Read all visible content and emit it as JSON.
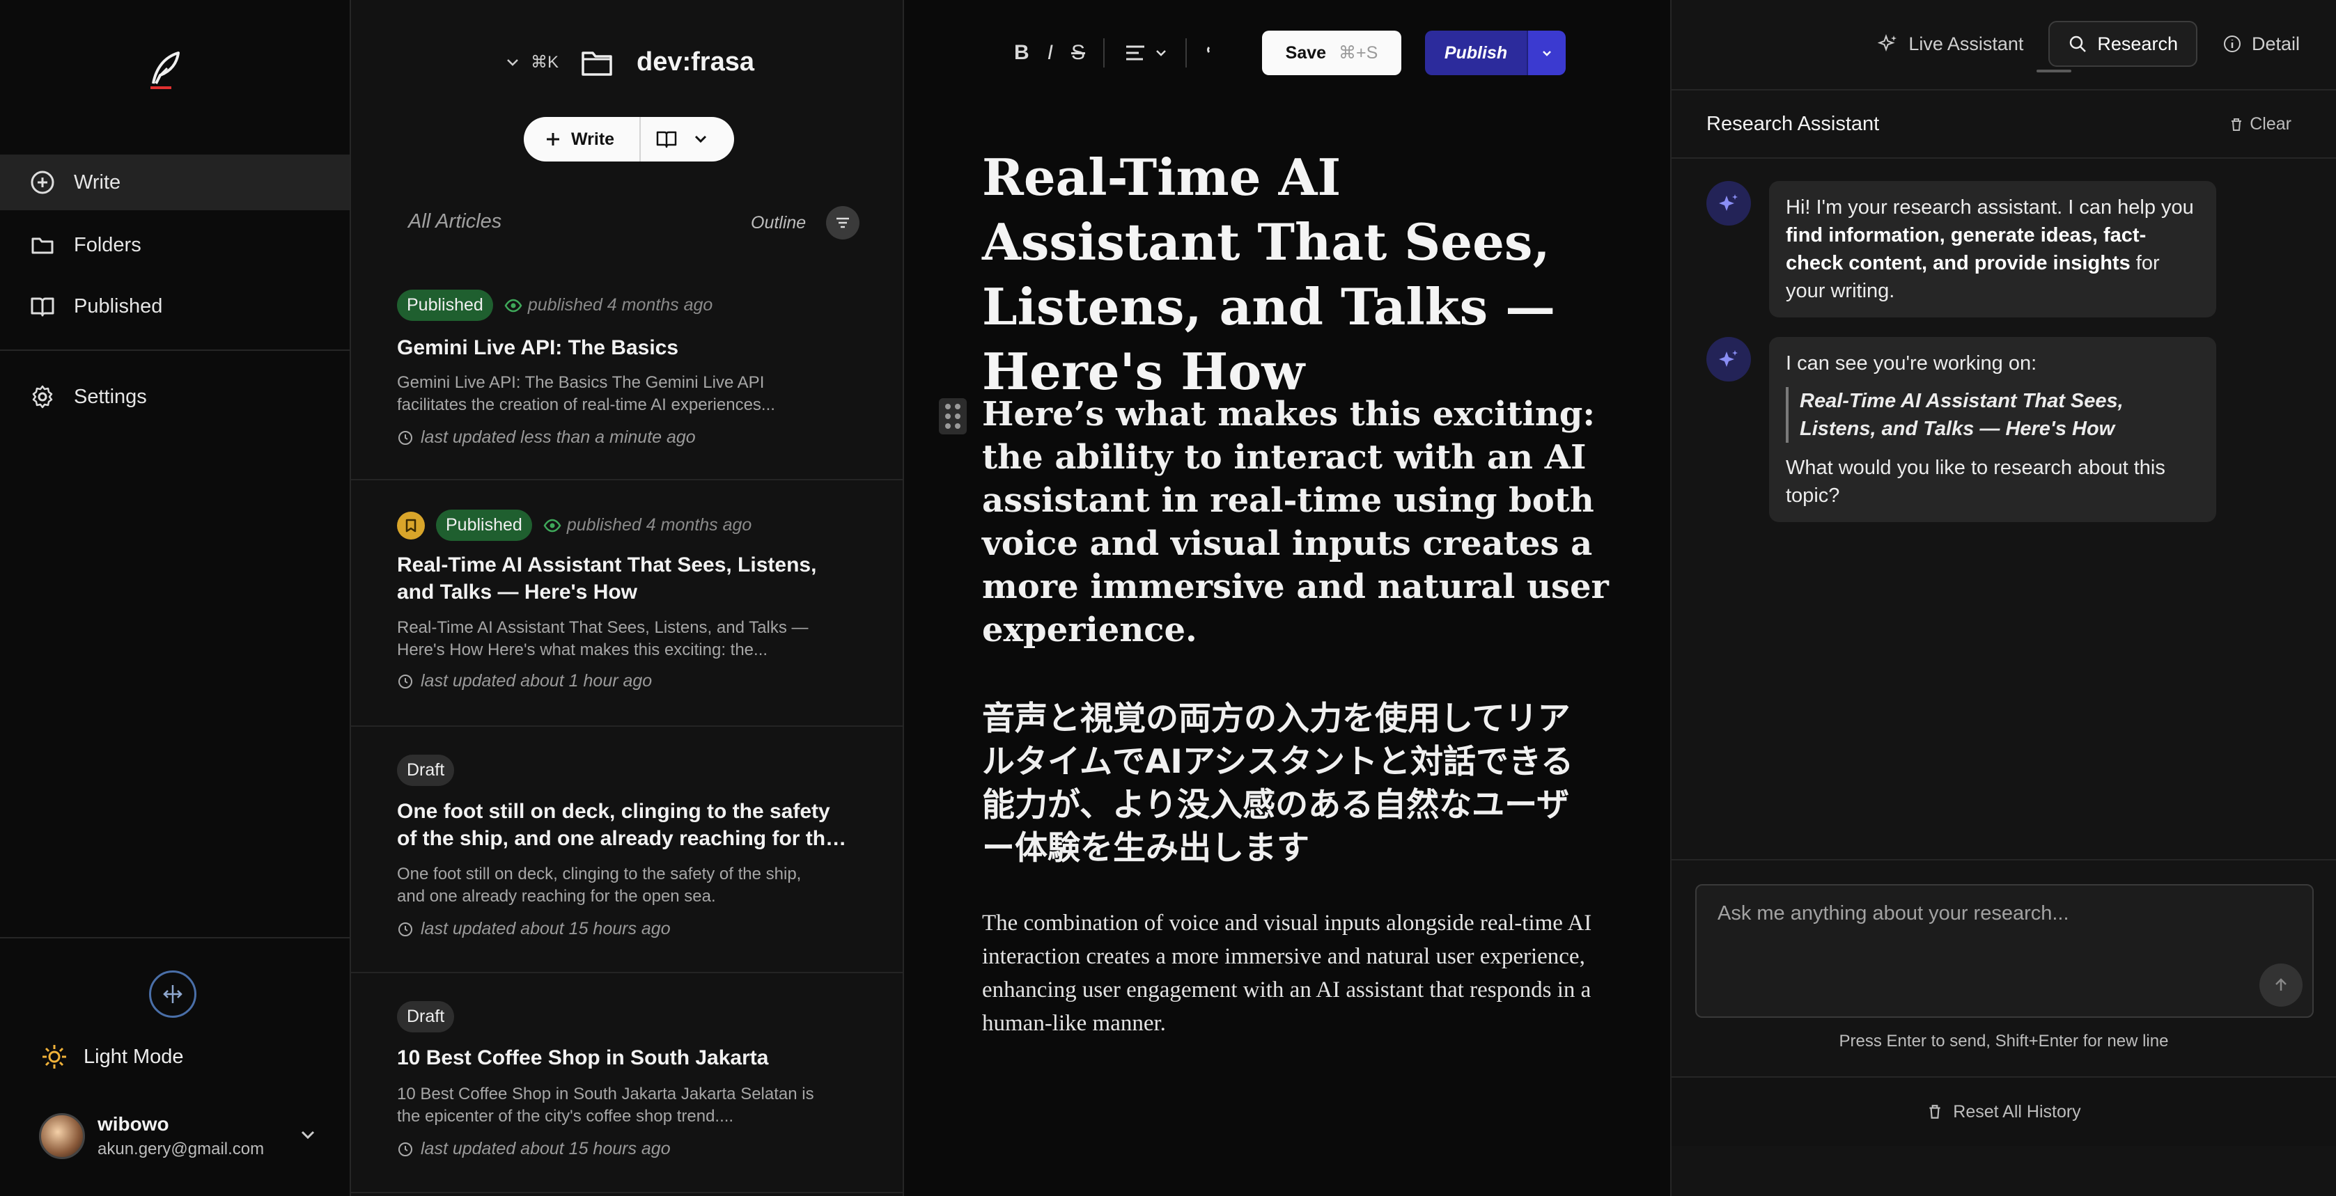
{
  "nav": {
    "items": [
      {
        "label": "Write",
        "icon": "plus-circle-icon"
      },
      {
        "label": "Folders",
        "icon": "folder-icon"
      },
      {
        "label": "Published",
        "icon": "book-icon"
      },
      {
        "label": "Settings",
        "icon": "gear-icon"
      }
    ],
    "theme_label": "Light Mode",
    "user": {
      "name": "wibowo",
      "email": "akun.gery@gmail.com"
    }
  },
  "list": {
    "shortcut": "⌘K",
    "workspace": "dev:frasa",
    "write_label": "Write",
    "all_articles": "All Articles",
    "outline": "Outline",
    "articles": [
      {
        "status": "Published",
        "published": "published 4 months ago",
        "title": "Gemini Live API: The Basics",
        "excerpt": "Gemini Live API: The Basics The Gemini Live API facilitates the creation of real-time AI experiences...",
        "updated": "last updated less than a minute ago"
      },
      {
        "status": "Published",
        "published": "published 4 months ago",
        "title": "Real-Time AI Assistant That Sees, Listens, and Talks — Here's How",
        "excerpt": "Real-Time AI Assistant That Sees, Listens, and Talks — Here's How Here's what makes this exciting: the...",
        "updated": "last updated about 1 hour ago"
      },
      {
        "status": "Draft",
        "title": "One foot still on deck, clinging to the safety of the ship, and one already reaching for the open sea.",
        "excerpt": "One foot still on deck, clinging to the safety of the ship, and one already reaching for the open sea.",
        "updated": "last updated about 15 hours ago"
      },
      {
        "status": "Draft",
        "title": "10 Best Coffee Shop in South Jakarta",
        "excerpt": "10 Best Coffee Shop in South Jakarta Jakarta Selatan is the epicenter of the city's coffee shop trend....",
        "updated": "last updated about 15 hours ago"
      }
    ]
  },
  "editor": {
    "toolbar": {
      "bold": "B",
      "italic": "I",
      "strike": "S",
      "save": "Save",
      "save_shortcut": "⌘+S",
      "publish": "Publish"
    },
    "title": "Real-Time AI Assistant That Sees, Listens, and Talks — Here's How",
    "heading": "Here’s what makes this exciting: the ability to interact with an AI assistant in real-time using both voice and visual inputs creates a more immersive and natural user experience.",
    "jp_heading": "音声と視覚の両方の入力を使用してリアルタイムでAIアシスタントと対話できる能力が、より没入感のある自然なユーザー体験を生み出します",
    "paragraph": "The combination of voice and visual inputs alongside real-time AI interaction creates a more immersive and natural user experience, enhancing user engagement with an AI assistant that responds in a human-like manner."
  },
  "assistant": {
    "tabs": [
      "Live Assistant",
      "Research",
      "Detail"
    ],
    "active_tab": "Research",
    "title": "Research Assistant",
    "clear": "Clear",
    "msg1": {
      "pre": "Hi! I'm your research assistant. I can help you ",
      "bold": "find information, generate ideas, fact-check content, and provide insights",
      "post": " for your writing."
    },
    "msg2": {
      "intro": "I can see you're working on:",
      "quote": "Real-Time AI Assistant That Sees, Listens, and Talks — Here's How",
      "question": "What would you like to research about this topic?"
    },
    "input_placeholder": "Ask me anything about your research...",
    "hint": "Press Enter to send, Shift+Enter for new line",
    "reset": "Reset All History"
  },
  "colors": {
    "accent": "#2c2b9c",
    "published_badge": "#1f5f2f",
    "pin": "#d9a52a"
  }
}
